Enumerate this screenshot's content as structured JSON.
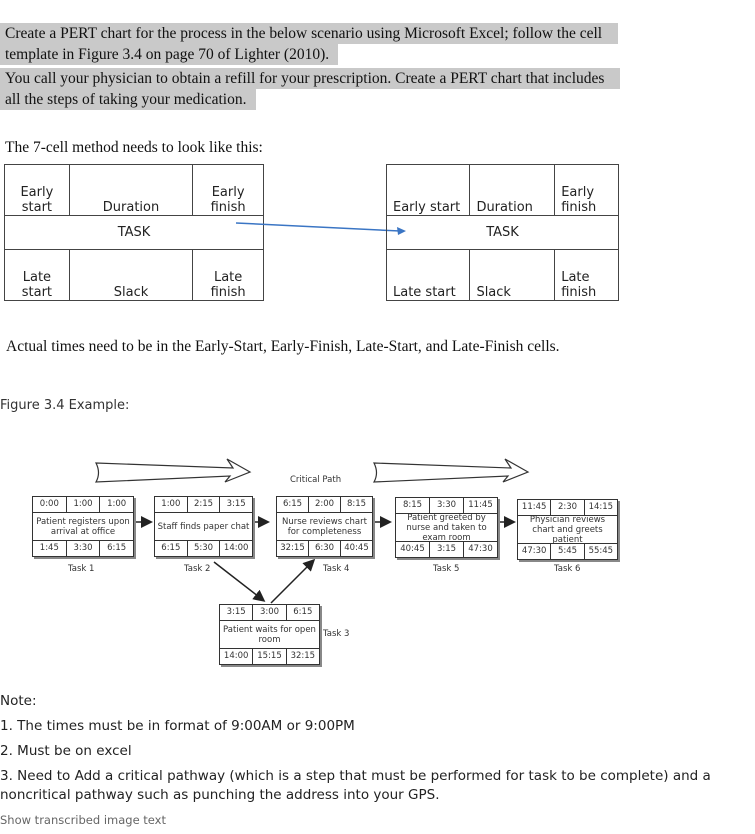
{
  "intro": {
    "line1": "Create a PERT chart for the process in the below scenario using Microsoft Excel; follow the cell",
    "line2": "template in Figure 3.4 on page 70 of Lighter (2010).",
    "line3": "You call your physician to obtain a refill for your prescription. Create a PERT chart that includes",
    "line4": "all the steps of taking your medication."
  },
  "seven_cell": {
    "heading": "The 7-cell method needs to look like this:",
    "left": {
      "early_start": "Early start",
      "duration": "Duration",
      "early_finish": "Early finish",
      "task": "TASK",
      "late_start": "Late start",
      "slack": "Slack",
      "late_finish": "Late finish"
    },
    "right": {
      "early_start": "Early start",
      "duration": "Duration",
      "early_finish": "Early finish",
      "task": "TASK",
      "late_start": "Late start",
      "slack": "Slack",
      "late_finish": "Late finish"
    },
    "connector_color": "#3a75c4"
  },
  "actual_times_note": "Actual times need to be in the Early-Start, Early-Finish, Late-Start, and Late-Finish cells.",
  "figure": {
    "caption": "Figure 3.4 Example:",
    "critical_path_label": "Critical Path",
    "tasks": [
      {
        "label": "Task 1",
        "top": [
          "0:00",
          "1:00",
          "1:00"
        ],
        "desc": "Patient registers upon arrival at office",
        "bottom": [
          "1:45",
          "3:30",
          "6:15"
        ]
      },
      {
        "label": "Task 2",
        "top": [
          "1:00",
          "2:15",
          "3:15"
        ],
        "desc": "Staff finds paper chat",
        "bottom": [
          "6:15",
          "5:30",
          "14:00"
        ]
      },
      {
        "label": "Task 3",
        "top": [
          "3:15",
          "3:00",
          "6:15"
        ],
        "desc": "Patient waits for open room",
        "bottom": [
          "14:00",
          "15:15",
          "32:15"
        ]
      },
      {
        "label": "Task 4",
        "top": [
          "6:15",
          "2:00",
          "8:15"
        ],
        "desc": "Nurse reviews chart for completeness",
        "bottom": [
          "32:15",
          "6:30",
          "40:45"
        ]
      },
      {
        "label": "Task 5",
        "top": [
          "8:15",
          "3:30",
          "11:45"
        ],
        "desc": "Patient greeted by nurse and taken to exam room",
        "bottom": [
          "40:45",
          "3:15",
          "47:30"
        ]
      },
      {
        "label": "Task 6",
        "top": [
          "11:45",
          "2:30",
          "14:15"
        ],
        "desc": "Physician reviews chart and greets patient",
        "bottom": [
          "47:30",
          "5:45",
          "55:45"
        ]
      }
    ]
  },
  "notes": {
    "title": "Note:",
    "items": [
      "1. The times must be in format of 9:00AM or 9:00PM",
      "2. Must be on excel",
      "3. Need to Add a critical pathway (which is a step that must be performed for task to be complete) and a",
      "noncritical pathway such as punching the address into your GPS."
    ],
    "show_transcribed": "Show transcribed image text"
  }
}
